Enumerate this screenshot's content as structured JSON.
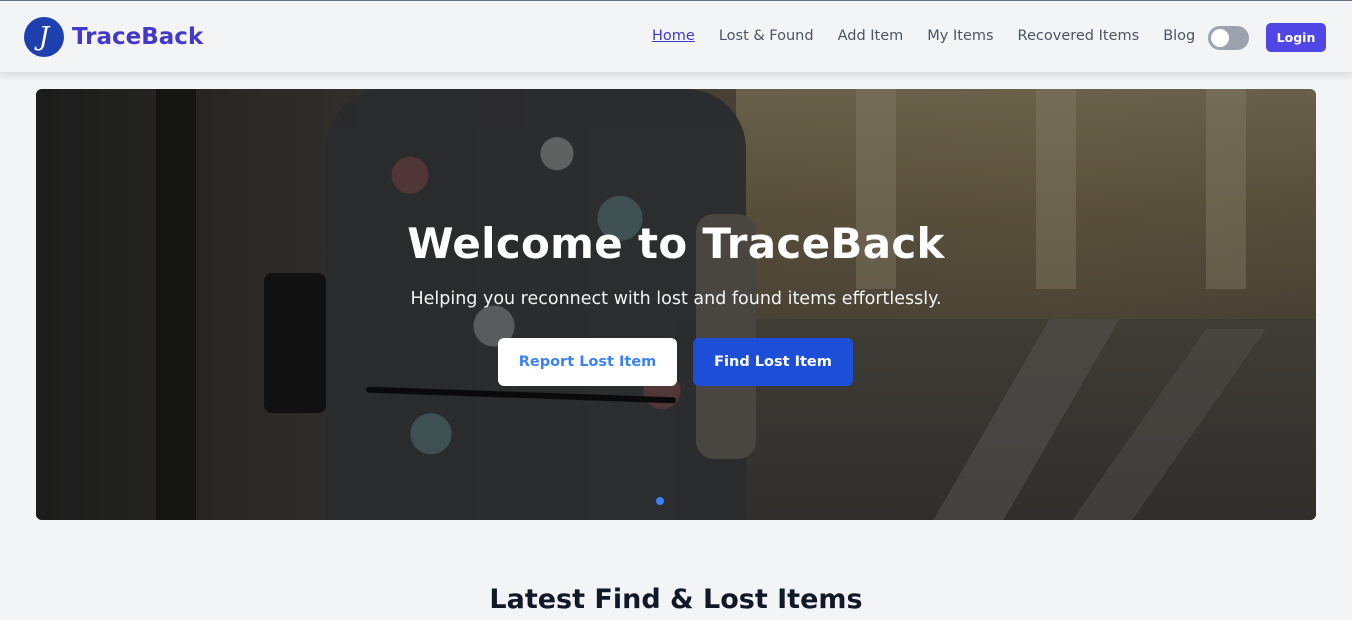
{
  "brand": {
    "logo_letter": "J",
    "name": "TraceBack"
  },
  "nav": {
    "links": [
      {
        "label": "Home",
        "active": true
      },
      {
        "label": "Lost & Found",
        "active": false
      },
      {
        "label": "Add Item",
        "active": false
      },
      {
        "label": "My Items",
        "active": false
      },
      {
        "label": "Recovered Items",
        "active": false
      },
      {
        "label": "Blog",
        "active": false
      }
    ],
    "theme_toggle": {
      "on": false
    },
    "login_label": "Login"
  },
  "hero": {
    "title": "Welcome to TraceBack",
    "subtitle": "Helping you reconnect with lost and found items effortlessly.",
    "report_button": "Report Lost Item",
    "find_button": "Find Lost Item",
    "slide_indicator": {
      "current": 1,
      "total": 1
    }
  },
  "latest_section": {
    "title": "Latest Find & Lost Items"
  },
  "colors": {
    "brand_text": "#4338ca",
    "logo_bg": "#1e40af",
    "login_bg": "#4f46e5",
    "find_button_bg": "#1d4ed8",
    "report_button_text": "#3b82f6",
    "page_bg": "#f3f4f6"
  }
}
